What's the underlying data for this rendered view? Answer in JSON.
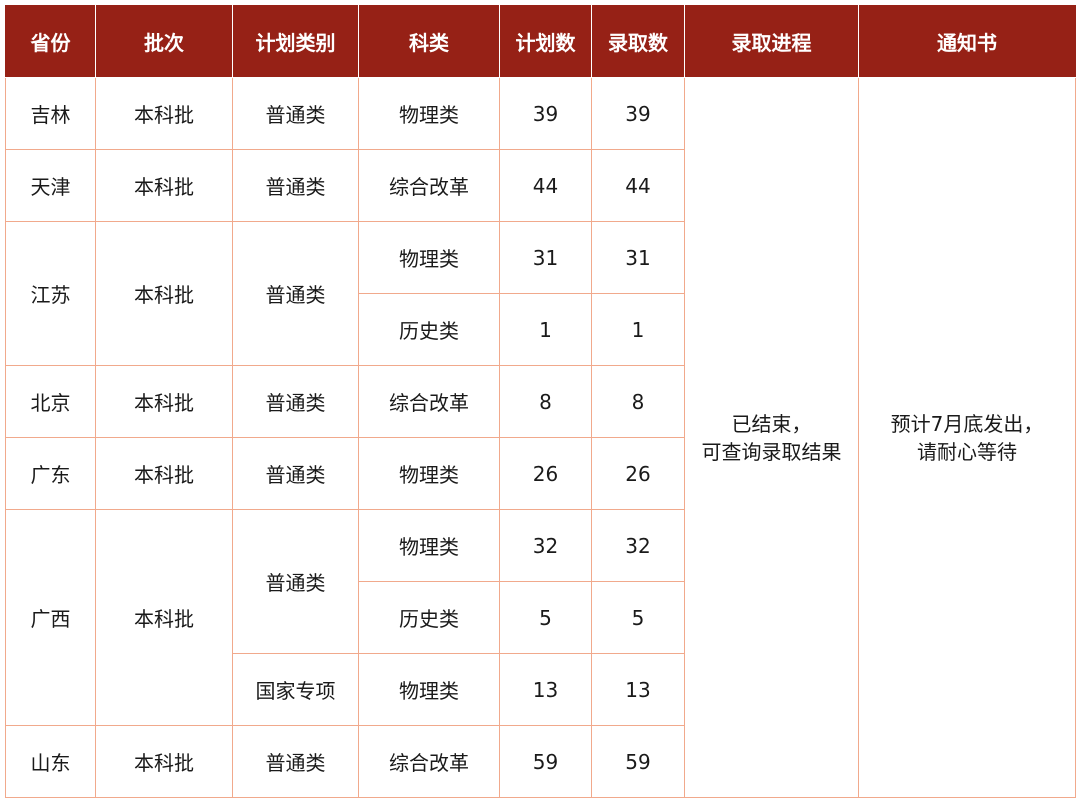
{
  "colors": {
    "header_bg": "#962116",
    "header_text": "#ffffff",
    "border": "#f1a98c",
    "text": "#1a1a1a"
  },
  "headers": [
    "省份",
    "批次",
    "计划类别",
    "科类",
    "计划数",
    "录取数",
    "录取进程",
    "通知书"
  ],
  "rows": [
    {
      "province": "吉林",
      "batch": "本科批",
      "category": "普通类",
      "subject": "物理类",
      "plan": "39",
      "admit": "39"
    },
    {
      "province": "天津",
      "batch": "本科批",
      "category": "普通类",
      "subject": "综合改革",
      "plan": "44",
      "admit": "44"
    },
    {
      "province": "江苏",
      "batch": "本科批",
      "category": "普通类",
      "subject": "物理类",
      "plan": "31",
      "admit": "31"
    },
    {
      "subject": "历史类",
      "plan": "1",
      "admit": "1"
    },
    {
      "province": "北京",
      "batch": "本科批",
      "category": "普通类",
      "subject": "综合改革",
      "plan": "8",
      "admit": "8"
    },
    {
      "province": "广东",
      "batch": "本科批",
      "category": "普通类",
      "subject": "物理类",
      "plan": "26",
      "admit": "26"
    },
    {
      "province": "广西",
      "batch": "本科批",
      "category": "普通类",
      "subject": "物理类",
      "plan": "32",
      "admit": "32"
    },
    {
      "subject": "历史类",
      "plan": "5",
      "admit": "5"
    },
    {
      "category": "国家专项",
      "subject": "物理类",
      "plan": "13",
      "admit": "13"
    },
    {
      "province": "山东",
      "batch": "本科批",
      "category": "普通类",
      "subject": "综合改革",
      "plan": "59",
      "admit": "59"
    }
  ],
  "progress": {
    "line1": "已结束，",
    "line2": "可查询录取结果"
  },
  "notice": {
    "line1": "预计7月底发出，",
    "line2": "请耐心等待"
  }
}
